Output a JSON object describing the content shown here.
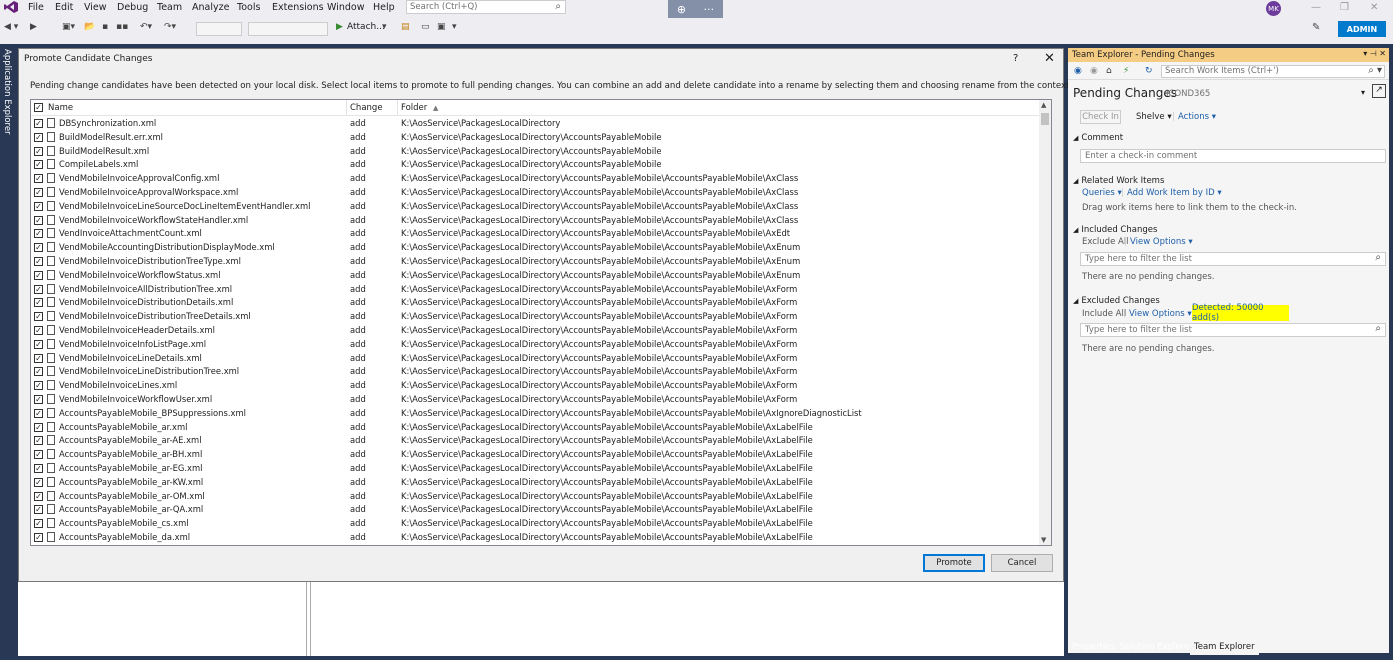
{
  "menu": [
    "File",
    "Edit",
    "View",
    "Debug",
    "Team",
    "Analyze",
    "Tools",
    "Extensions",
    "Window",
    "Help"
  ],
  "quick_search_placeholder": "Search (Ctrl+Q)",
  "user_initials": "MK",
  "admin_label": "ADMIN",
  "toolbar": {
    "attach_label": "Attach..."
  },
  "left_strip": "Application Explorer",
  "dialog": {
    "title": "Promote Candidate Changes",
    "help": "?",
    "close": "✕",
    "description": "Pending change candidates have been detected on your local disk. Select local items to promote to full pending changes. You can combine an add and delete candidate into a rename by selecting them and choosing rename from the context menu.",
    "columns": {
      "name": "Name",
      "change": "Change",
      "folder": "Folder"
    },
    "rows": [
      {
        "name": "DBSynchronization.xml",
        "change": "add",
        "folder": "K:\\AosService\\PackagesLocalDirectory"
      },
      {
        "name": "BuildModelResult.err.xml",
        "change": "add",
        "folder": "K:\\AosService\\PackagesLocalDirectory\\AccountsPayableMobile"
      },
      {
        "name": "BuildModelResult.xml",
        "change": "add",
        "folder": "K:\\AosService\\PackagesLocalDirectory\\AccountsPayableMobile"
      },
      {
        "name": "CompileLabels.xml",
        "change": "add",
        "folder": "K:\\AosService\\PackagesLocalDirectory\\AccountsPayableMobile"
      },
      {
        "name": "VendMobileInvoiceApprovalConfig.xml",
        "change": "add",
        "folder": "K:\\AosService\\PackagesLocalDirectory\\AccountsPayableMobile\\AccountsPayableMobile\\AxClass"
      },
      {
        "name": "VendMobileInvoiceApprovalWorkspace.xml",
        "change": "add",
        "folder": "K:\\AosService\\PackagesLocalDirectory\\AccountsPayableMobile\\AccountsPayableMobile\\AxClass"
      },
      {
        "name": "VendMobileInvoiceLineSourceDocLineItemEventHandler.xml",
        "change": "add",
        "folder": "K:\\AosService\\PackagesLocalDirectory\\AccountsPayableMobile\\AccountsPayableMobile\\AxClass"
      },
      {
        "name": "VendMobileInvoiceWorkflowStateHandler.xml",
        "change": "add",
        "folder": "K:\\AosService\\PackagesLocalDirectory\\AccountsPayableMobile\\AccountsPayableMobile\\AxClass"
      },
      {
        "name": "VendInvoiceAttachmentCount.xml",
        "change": "add",
        "folder": "K:\\AosService\\PackagesLocalDirectory\\AccountsPayableMobile\\AccountsPayableMobile\\AxEdt"
      },
      {
        "name": "VendMobileAccountingDistributionDisplayMode.xml",
        "change": "add",
        "folder": "K:\\AosService\\PackagesLocalDirectory\\AccountsPayableMobile\\AccountsPayableMobile\\AxEnum"
      },
      {
        "name": "VendMobileInvoiceDistributionTreeType.xml",
        "change": "add",
        "folder": "K:\\AosService\\PackagesLocalDirectory\\AccountsPayableMobile\\AccountsPayableMobile\\AxEnum"
      },
      {
        "name": "VendMobileInvoiceWorkflowStatus.xml",
        "change": "add",
        "folder": "K:\\AosService\\PackagesLocalDirectory\\AccountsPayableMobile\\AccountsPayableMobile\\AxEnum"
      },
      {
        "name": "VendMobileInvoiceAllDistributionTree.xml",
        "change": "add",
        "folder": "K:\\AosService\\PackagesLocalDirectory\\AccountsPayableMobile\\AccountsPayableMobile\\AxForm"
      },
      {
        "name": "VendMobileInvoiceDistributionDetails.xml",
        "change": "add",
        "folder": "K:\\AosService\\PackagesLocalDirectory\\AccountsPayableMobile\\AccountsPayableMobile\\AxForm"
      },
      {
        "name": "VendMobileInvoiceDistributionTreeDetails.xml",
        "change": "add",
        "folder": "K:\\AosService\\PackagesLocalDirectory\\AccountsPayableMobile\\AccountsPayableMobile\\AxForm"
      },
      {
        "name": "VendMobileInvoiceHeaderDetails.xml",
        "change": "add",
        "folder": "K:\\AosService\\PackagesLocalDirectory\\AccountsPayableMobile\\AccountsPayableMobile\\AxForm"
      },
      {
        "name": "VendMobileInvoiceInfoListPage.xml",
        "change": "add",
        "folder": "K:\\AosService\\PackagesLocalDirectory\\AccountsPayableMobile\\AccountsPayableMobile\\AxForm"
      },
      {
        "name": "VendMobileInvoiceLineDetails.xml",
        "change": "add",
        "folder": "K:\\AosService\\PackagesLocalDirectory\\AccountsPayableMobile\\AccountsPayableMobile\\AxForm"
      },
      {
        "name": "VendMobileInvoiceLineDistributionTree.xml",
        "change": "add",
        "folder": "K:\\AosService\\PackagesLocalDirectory\\AccountsPayableMobile\\AccountsPayableMobile\\AxForm"
      },
      {
        "name": "VendMobileInvoiceLines.xml",
        "change": "add",
        "folder": "K:\\AosService\\PackagesLocalDirectory\\AccountsPayableMobile\\AccountsPayableMobile\\AxForm"
      },
      {
        "name": "VendMobileInvoiceWorkflowUser.xml",
        "change": "add",
        "folder": "K:\\AosService\\PackagesLocalDirectory\\AccountsPayableMobile\\AccountsPayableMobile\\AxForm"
      },
      {
        "name": "AccountsPayableMobile_BPSuppressions.xml",
        "change": "add",
        "folder": "K:\\AosService\\PackagesLocalDirectory\\AccountsPayableMobile\\AccountsPayableMobile\\AxIgnoreDiagnosticList"
      },
      {
        "name": "AccountsPayableMobile_ar.xml",
        "change": "add",
        "folder": "K:\\AosService\\PackagesLocalDirectory\\AccountsPayableMobile\\AccountsPayableMobile\\AxLabelFile"
      },
      {
        "name": "AccountsPayableMobile_ar-AE.xml",
        "change": "add",
        "folder": "K:\\AosService\\PackagesLocalDirectory\\AccountsPayableMobile\\AccountsPayableMobile\\AxLabelFile"
      },
      {
        "name": "AccountsPayableMobile_ar-BH.xml",
        "change": "add",
        "folder": "K:\\AosService\\PackagesLocalDirectory\\AccountsPayableMobile\\AccountsPayableMobile\\AxLabelFile"
      },
      {
        "name": "AccountsPayableMobile_ar-EG.xml",
        "change": "add",
        "folder": "K:\\AosService\\PackagesLocalDirectory\\AccountsPayableMobile\\AccountsPayableMobile\\AxLabelFile"
      },
      {
        "name": "AccountsPayableMobile_ar-KW.xml",
        "change": "add",
        "folder": "K:\\AosService\\PackagesLocalDirectory\\AccountsPayableMobile\\AccountsPayableMobile\\AxLabelFile"
      },
      {
        "name": "AccountsPayableMobile_ar-OM.xml",
        "change": "add",
        "folder": "K:\\AosService\\PackagesLocalDirectory\\AccountsPayableMobile\\AccountsPayableMobile\\AxLabelFile"
      },
      {
        "name": "AccountsPayableMobile_ar-QA.xml",
        "change": "add",
        "folder": "K:\\AosService\\PackagesLocalDirectory\\AccountsPayableMobile\\AccountsPayableMobile\\AxLabelFile"
      },
      {
        "name": "AccountsPayableMobile_cs.xml",
        "change": "add",
        "folder": "K:\\AosService\\PackagesLocalDirectory\\AccountsPayableMobile\\AccountsPayableMobile\\AxLabelFile"
      },
      {
        "name": "AccountsPayableMobile_da.xml",
        "change": "add",
        "folder": "K:\\AosService\\PackagesLocalDirectory\\AccountsPayableMobile\\AccountsPayableMobile\\AxLabelFile"
      }
    ],
    "promote_label": "Promote",
    "cancel_label": "Cancel"
  },
  "team_explorer": {
    "title": "Team Explorer - Pending Changes",
    "search_placeholder": "Search Work Items (Ctrl+')",
    "heading": "Pending Changes",
    "workspace": "ICOND365",
    "checkin_label": "Check In",
    "shelve_label": "Shelve",
    "actions_label": "Actions",
    "comment_section": "Comment",
    "comment_placeholder": "Enter a check-in comment",
    "related_section": "Related Work Items",
    "queries_label": "Queries",
    "add_work_item_label": "Add Work Item by ID",
    "related_hint": "Drag work items here to link them to the check-in.",
    "included_section": "Included Changes",
    "exclude_all_label": "Exclude All",
    "view_options_label": "View Options",
    "filter_placeholder": "Type here to filter the list",
    "no_changes": "There are no pending changes.",
    "excluded_section": "Excluded Changes",
    "include_all_label": "Include All",
    "detected_label": "Detected: 50000 add(s)",
    "highlight_color": "#ffff00"
  },
  "bottom_tabs": [
    "Properties",
    "Solution Explorer",
    "Team Explorer"
  ],
  "active_tab": "Team Explorer"
}
